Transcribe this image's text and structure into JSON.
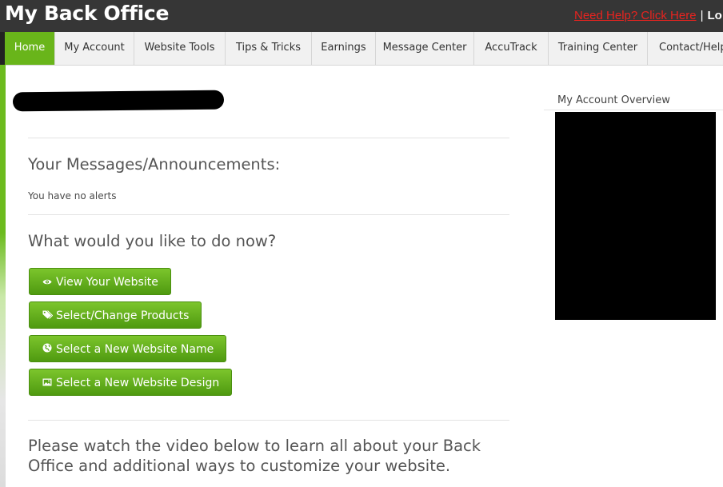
{
  "header": {
    "title": "My Back Office",
    "help_link": "Need Help? Click Here",
    "separator": "|",
    "logout_partial": "Lo"
  },
  "nav": {
    "tabs": [
      {
        "label": "Home",
        "active": true
      },
      {
        "label": "My Account",
        "active": false
      },
      {
        "label": "Website Tools",
        "active": false
      },
      {
        "label": "Tips & Tricks",
        "active": false
      },
      {
        "label": "Earnings",
        "active": false
      },
      {
        "label": "Message Center",
        "active": false
      },
      {
        "label": "AccuTrack",
        "active": false
      },
      {
        "label": "Training Center",
        "active": false
      },
      {
        "label": "Contact/Help",
        "active": false
      }
    ]
  },
  "main": {
    "messages_heading": "Your Messages/Announcements:",
    "alerts_text": "You have no alerts",
    "actions_heading": "What would you like to do now?",
    "buttons": [
      {
        "label": "View Your Website",
        "icon": "eye-icon"
      },
      {
        "label": "Select/Change Products",
        "icon": "tags-icon"
      },
      {
        "label": "Select a New Website Name",
        "icon": "globe-icon"
      },
      {
        "label": "Select a New Website Design",
        "icon": "picture-icon"
      }
    ],
    "video_heading": "Please watch the video below to learn all about your Back Office and additional ways to customize your website."
  },
  "sidebar": {
    "overview_title": "My Account Overview"
  },
  "colors": {
    "header_bg": "#363636",
    "accent_green": "#69b51a",
    "help_link_red": "#e8231f",
    "heading_gray": "#555555"
  }
}
